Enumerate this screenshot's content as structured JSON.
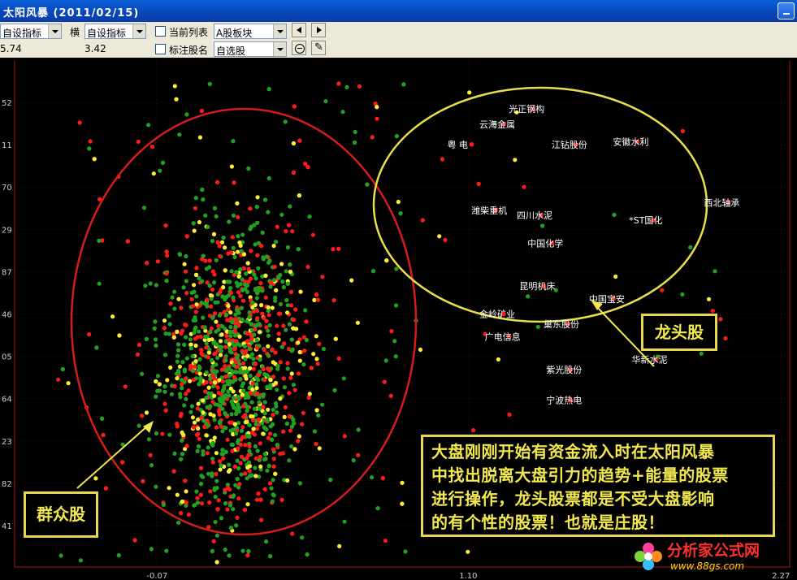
{
  "window": {
    "title": "太阳风暴 (2011/02/15)"
  },
  "toolbar": {
    "combo_x": "自设指标",
    "label_horizontal": "横",
    "combo_y": "自设指标",
    "chk_current_list": "当前列表",
    "combo_board": "A股板块",
    "chk_mark_name": "标注股名",
    "combo_selected": "自选股",
    "readout_left": "5.74",
    "readout_right": "3.42"
  },
  "colors": {
    "up": "#ff1a1a",
    "down": "#22a022",
    "flat": "#ffee33",
    "ellipse_crowd": "#d41c1c",
    "ellipse_leader": "#e8e04a",
    "callout": "#f2e84e"
  },
  "chart_data": {
    "type": "scatter",
    "x_axis": {
      "ticks": [
        "-0.07",
        "1.10",
        "2.27"
      ],
      "range": [
        -0.6,
        2.3
      ]
    },
    "y_axis": {
      "ticks": [
        "52",
        "11",
        "70",
        "29",
        "87",
        "46",
        "05",
        "64",
        "23",
        "82",
        "41"
      ]
    },
    "grid": true,
    "series": [
      {
        "color": "up"
      },
      {
        "color": "down"
      },
      {
        "color": "flat"
      }
    ],
    "labeled_points": [
      {
        "name": "光正钢构",
        "x": 1.34,
        "y": 0.905
      },
      {
        "name": "云海金属",
        "x": 1.23,
        "y": 0.875
      },
      {
        "name": "粤 电",
        "x": 1.11,
        "y": 0.835
      },
      {
        "name": "江钻股份",
        "x": 1.5,
        "y": 0.835
      },
      {
        "name": "安徽水利",
        "x": 1.73,
        "y": 0.84
      },
      {
        "name": "西北轴承",
        "x": 2.07,
        "y": 0.72
      },
      {
        "name": "潍柴重机",
        "x": 1.2,
        "y": 0.705
      },
      {
        "name": "四川水泥",
        "x": 1.37,
        "y": 0.695
      },
      {
        "name": "*ST国化",
        "x": 1.79,
        "y": 0.685
      },
      {
        "name": "中国化学",
        "x": 1.41,
        "y": 0.64
      },
      {
        "name": "昆明机床",
        "x": 1.38,
        "y": 0.555
      },
      {
        "name": "中国宝安",
        "x": 1.64,
        "y": 0.53
      },
      {
        "name": "金岭矿业",
        "x": 1.23,
        "y": 0.5
      },
      {
        "name": "巢东股份",
        "x": 1.47,
        "y": 0.48
      },
      {
        "name": "广电信息",
        "x": 1.25,
        "y": 0.455
      },
      {
        "name": "华新水泥",
        "x": 1.8,
        "y": 0.41
      },
      {
        "name": "紫光股份",
        "x": 1.48,
        "y": 0.39
      },
      {
        "name": "宁波热电",
        "x": 1.48,
        "y": 0.33
      }
    ]
  },
  "annotations": {
    "leader": "龙头股",
    "crowd": "群众股",
    "note_lines": [
      "大盘刚刚开始有资金流入时在太阳风暴",
      "中找出脱离大盘引力的趋势+能量的股票",
      "进行操作，龙头股票都是不受大盘影响",
      "的有个性的股票！也就是庄股！"
    ]
  },
  "watermark": {
    "name": "分析家公式网",
    "url": "www.88gs.com"
  }
}
